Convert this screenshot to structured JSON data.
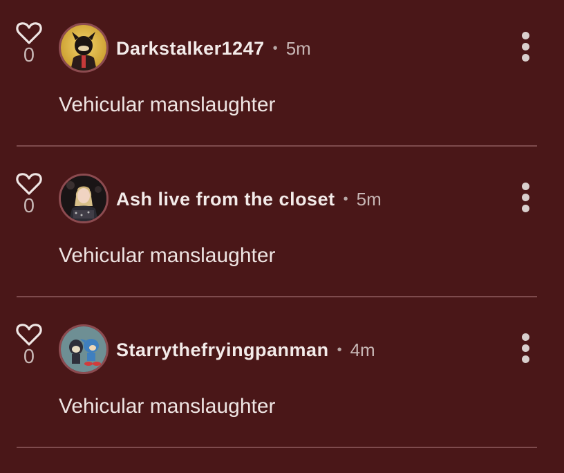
{
  "comments": [
    {
      "likes": "0",
      "username": "Darkstalker1247",
      "separator": "•",
      "time": "5m",
      "text": "Vehicular manslaughter",
      "avatar_icon": "cartoon-demon-avatar"
    },
    {
      "likes": "0",
      "username": "Ash live from the closet",
      "separator": "•",
      "time": "5m",
      "text": "Vehicular manslaughter",
      "avatar_icon": "performer-photo-avatar"
    },
    {
      "likes": "0",
      "username": "Starrythefryingpanman",
      "separator": "•",
      "time": "4m",
      "text": "Vehicular manslaughter",
      "avatar_icon": "cartoon-characters-avatar"
    }
  ],
  "colors": {
    "background": "#4a1718",
    "divider": "#7e4b4d",
    "avatar_ring": "#8c4b50"
  }
}
